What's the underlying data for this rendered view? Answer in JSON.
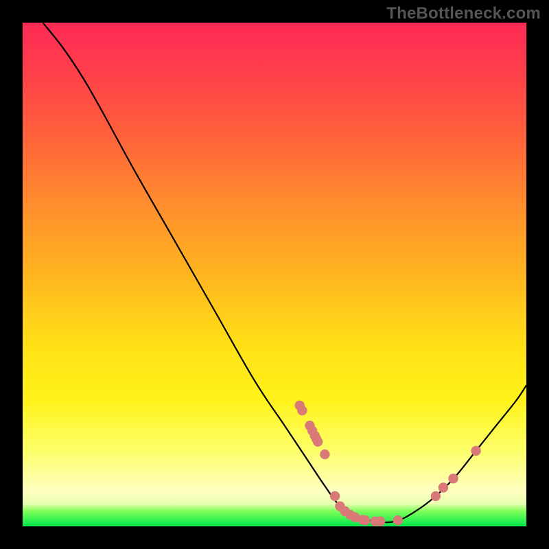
{
  "watermark": "TheBottleneck.com",
  "colors": {
    "background": "#000000",
    "curve": "#000000",
    "marker": "#d97a78",
    "gradient_top": "#ff2a55",
    "gradient_bottom": "#00e84a"
  },
  "chart_data": {
    "type": "line",
    "title": "",
    "xlabel": "",
    "ylabel": "",
    "xlim": [
      0,
      100
    ],
    "ylim": [
      0,
      100
    ],
    "grid": false,
    "legend": false,
    "curve": [
      {
        "x": 4,
        "y": 100
      },
      {
        "x": 8,
        "y": 95
      },
      {
        "x": 12,
        "y": 89
      },
      {
        "x": 16,
        "y": 82
      },
      {
        "x": 22,
        "y": 71
      },
      {
        "x": 30,
        "y": 57
      },
      {
        "x": 38,
        "y": 43
      },
      {
        "x": 46,
        "y": 29
      },
      {
        "x": 52,
        "y": 20
      },
      {
        "x": 56,
        "y": 14
      },
      {
        "x": 60,
        "y": 8
      },
      {
        "x": 63,
        "y": 4
      },
      {
        "x": 66,
        "y": 2
      },
      {
        "x": 70,
        "y": 1
      },
      {
        "x": 74,
        "y": 1
      },
      {
        "x": 78,
        "y": 3
      },
      {
        "x": 82,
        "y": 6
      },
      {
        "x": 86,
        "y": 10
      },
      {
        "x": 90,
        "y": 15
      },
      {
        "x": 94,
        "y": 20
      },
      {
        "x": 98,
        "y": 25
      },
      {
        "x": 100,
        "y": 28
      }
    ],
    "markers": [
      {
        "x": 55,
        "y": 24
      },
      {
        "x": 55.5,
        "y": 23
      },
      {
        "x": 57,
        "y": 20
      },
      {
        "x": 57.5,
        "y": 19
      },
      {
        "x": 58,
        "y": 18
      },
      {
        "x": 58.3,
        "y": 17.4
      },
      {
        "x": 58.6,
        "y": 16.8
      },
      {
        "x": 60,
        "y": 14.3
      },
      {
        "x": 62,
        "y": 6
      },
      {
        "x": 63,
        "y": 4
      },
      {
        "x": 64,
        "y": 3
      },
      {
        "x": 65,
        "y": 2.3
      },
      {
        "x": 66,
        "y": 1.8
      },
      {
        "x": 67.5,
        "y": 1.3
      },
      {
        "x": 68,
        "y": 1.2
      },
      {
        "x": 70,
        "y": 1
      },
      {
        "x": 71,
        "y": 1
      },
      {
        "x": 74.5,
        "y": 1.2
      },
      {
        "x": 82,
        "y": 6
      },
      {
        "x": 83.5,
        "y": 7.7
      },
      {
        "x": 85.5,
        "y": 9.5
      },
      {
        "x": 90,
        "y": 15
      }
    ]
  }
}
